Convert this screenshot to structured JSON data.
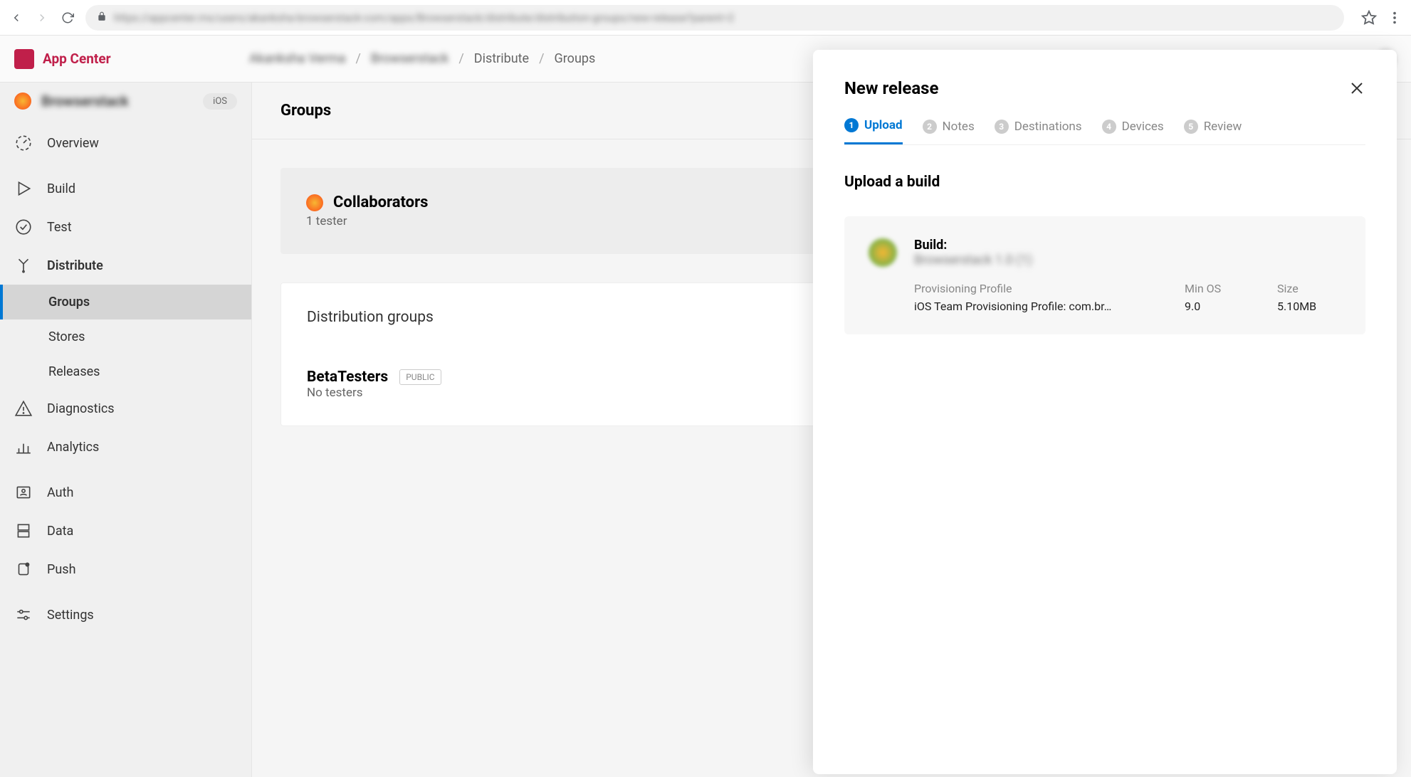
{
  "header": {
    "product_name": "App Center",
    "breadcrumb_blur1": "Akanksha Verma",
    "breadcrumb_blur2": "Browserstack",
    "breadcrumb1": "Distribute",
    "breadcrumb2": "Groups"
  },
  "url_blur": "https://appcenter.ms/users/akanksha-browserstack-com/apps/Browserstack/distribute/distribution-groups/new-release?parent=2",
  "sidebar": {
    "app_name_blur": "Browserstack",
    "platform_badge": "iOS",
    "items": [
      {
        "label": "Overview",
        "icon": "gauge-icon"
      },
      {
        "label": "Build",
        "icon": "play-icon"
      },
      {
        "label": "Test",
        "icon": "check-circle-icon"
      },
      {
        "label": "Distribute",
        "icon": "branch-icon",
        "active": true,
        "children": [
          {
            "label": "Groups",
            "selected": true
          },
          {
            "label": "Stores"
          },
          {
            "label": "Releases"
          }
        ]
      },
      {
        "label": "Diagnostics",
        "icon": "warning-icon"
      },
      {
        "label": "Analytics",
        "icon": "bar-chart-icon"
      },
      {
        "label": "Auth",
        "icon": "person-card-icon"
      },
      {
        "label": "Data",
        "icon": "database-icon"
      },
      {
        "label": "Push",
        "icon": "bell-dot-icon"
      },
      {
        "label": "Settings",
        "icon": "sliders-icon"
      }
    ]
  },
  "content": {
    "page_title": "Groups",
    "collab_title": "Collaborators",
    "collab_sub": "1 tester",
    "dist_section_title": "Distribution groups",
    "beta_group": "BetaTesters",
    "beta_badge": "PUBLIC",
    "beta_sub": "No testers"
  },
  "panel": {
    "title": "New release",
    "steps": [
      {
        "num": "1",
        "label": "Upload",
        "active": true
      },
      {
        "num": "2",
        "label": "Notes"
      },
      {
        "num": "3",
        "label": "Destinations"
      },
      {
        "num": "4",
        "label": "Devices"
      },
      {
        "num": "5",
        "label": "Review"
      }
    ],
    "section_heading": "Upload a build",
    "build": {
      "label": "Build:",
      "name_blur": "Browserstack 1.0 (1)",
      "prov_label": "Provisioning Profile",
      "prov_val": "iOS Team Provisioning Profile: com.br…",
      "minos_label": "Min OS",
      "minos_val": "9.0",
      "size_label": "Size",
      "size_val": "5.10MB"
    }
  }
}
